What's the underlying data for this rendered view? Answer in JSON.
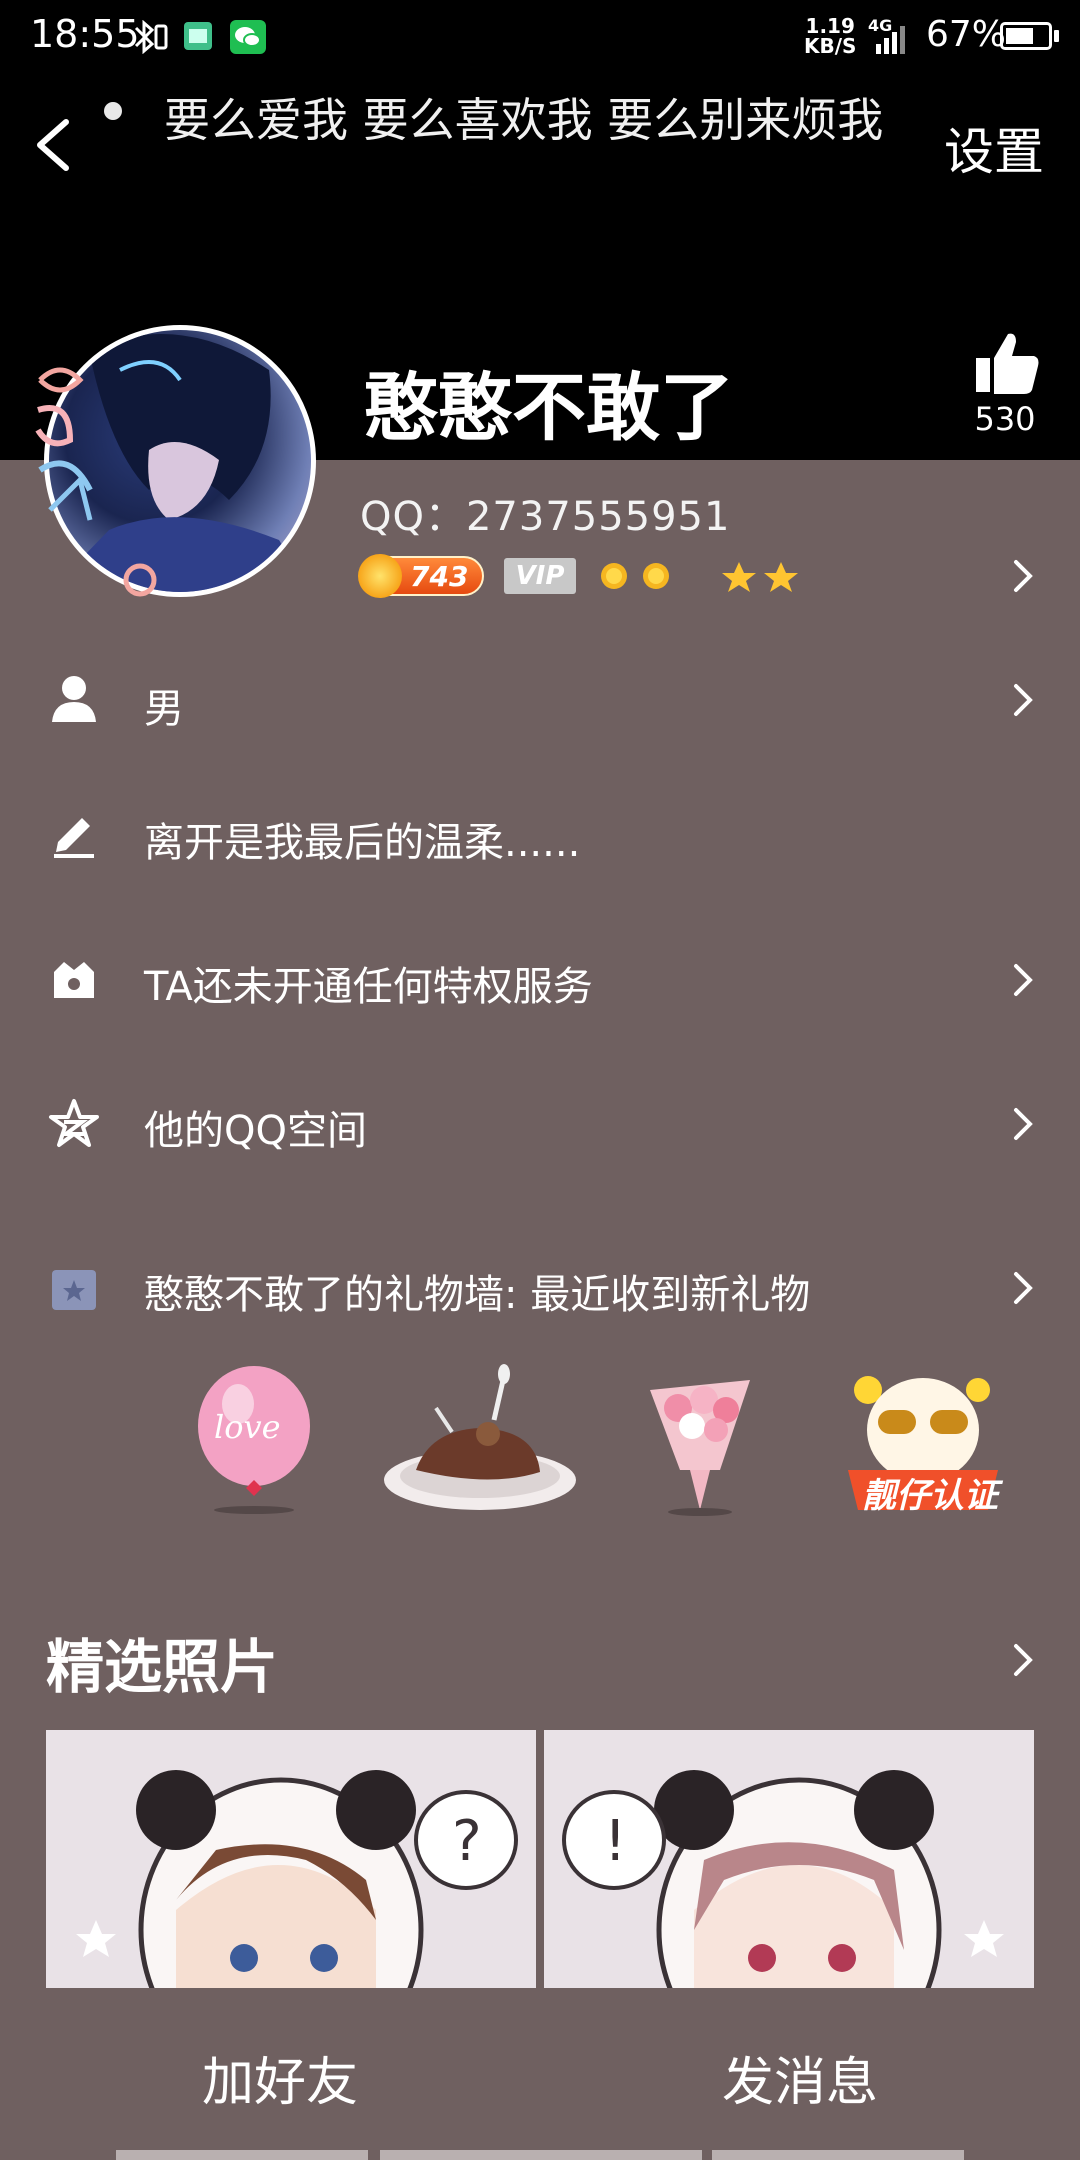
{
  "status_bar": {
    "time": "18:55",
    "net_speed": "1.19",
    "net_unit": "KB/S",
    "network_type": "4G",
    "battery_percent": "67%",
    "battery_level": 0.67
  },
  "header": {
    "signature": "要么爱我 要么喜欢我 要么别来烦我",
    "settings_label": "设置",
    "nickname": "憨憨不敢了",
    "like_count": "530"
  },
  "profile": {
    "qq_line": "QQ：2737555951",
    "coin_value": "743",
    "vip_label": "VIP"
  },
  "rows": {
    "gender": "男",
    "bio": "离开是我最后的温柔......",
    "privilege": "TA还未开通任何特权服务",
    "qzone": "他的QQ空间",
    "gift_wall": "憨憨不敢了的礼物墙: 最近收到新礼物"
  },
  "gifts": {
    "balloon_text": "love",
    "badge_text": "靓仔认证"
  },
  "photos": {
    "section_title": "精选照片"
  },
  "actions": {
    "add_friend": "加好友",
    "send_message": "发消息"
  },
  "colors": {
    "background": "#6f6060",
    "header": "#000000",
    "coin": "#f05a14"
  }
}
